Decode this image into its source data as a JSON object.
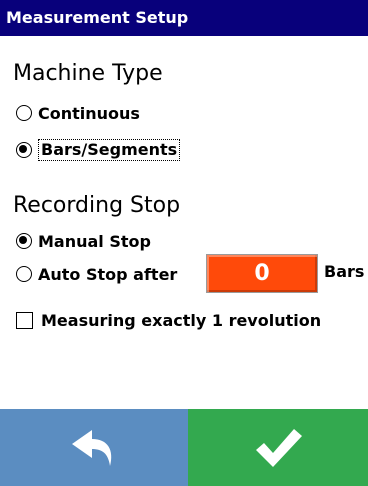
{
  "window": {
    "title": "Measurement Setup"
  },
  "machine_type": {
    "heading": "Machine Type",
    "options": [
      {
        "label": "Continuous",
        "selected": false
      },
      {
        "label": "Bars/Segments",
        "selected": true
      }
    ]
  },
  "recording_stop": {
    "heading": "Recording Stop",
    "manual": {
      "label": "Manual Stop",
      "selected": true
    },
    "auto": {
      "label": "Auto Stop after",
      "selected": false,
      "value": "0",
      "unit": "Bars"
    },
    "one_revolution": {
      "label": "Measuring exactly 1 revolution",
      "checked": false
    }
  },
  "footer": {
    "back_icon": "undo-arrow-icon",
    "confirm_icon": "checkmark-icon",
    "colors": {
      "back": "#5b8dc1",
      "confirm": "#33a94f",
      "title": "#08007b",
      "value_box": "#ff4a0a"
    }
  }
}
